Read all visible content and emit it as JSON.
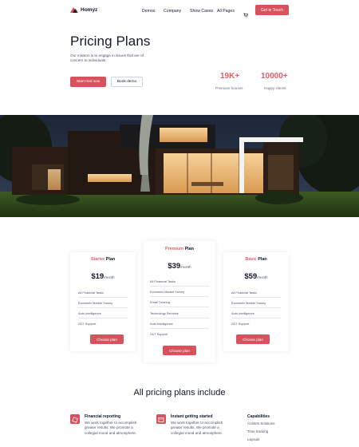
{
  "nav": {
    "brand": "Homyz",
    "menu": [
      "Demos",
      "Company",
      "Show Cases",
      "All Pages"
    ],
    "cta": "Get in Touch"
  },
  "hero": {
    "title": "Pricing Plans",
    "description": "Our mission is to engage in issues that are of concern to individuals",
    "primary_button": "Start trial now",
    "secondary_button": "Book demo",
    "stats": [
      {
        "value": "19K+",
        "label": "Premium houses"
      },
      {
        "value": "10000+",
        "label": "Happy clients"
      }
    ]
  },
  "plans": [
    {
      "name_accent": "Starter",
      "name_rest": " Plan",
      "price": "$19",
      "unit": "/month",
      "features": [
        "All Financial Tasks",
        "Economic Market Survey",
        "Auto Intelligence",
        "24/7 Support"
      ],
      "button": "Choose plan"
    },
    {
      "name_accent": "Premium",
      "name_rest": " Plan",
      "price": "$39",
      "unit": "/month",
      "features": [
        "All Financial Tasks",
        "Economic Market Survey",
        "Email Tutoring",
        "Technology Services",
        "Auto Intelligence",
        "24/7 Support"
      ],
      "button": "Choose plan"
    },
    {
      "name_accent": "Basic",
      "name_rest": " Plan",
      "price": "$59",
      "unit": "/month",
      "features": [
        "All Financial Tasks",
        "Economic Market Survey",
        "Auto Intelligence",
        "24/7 Support"
      ],
      "button": "Choose plan"
    }
  ],
  "includes": {
    "title": "All pricing plans include",
    "items": [
      {
        "heading": "Financial reporting",
        "body_lines": [
          "We work together to accomplish",
          "greater results. We promote a",
          "collegial mood and atmosphere."
        ]
      },
      {
        "heading": "Instant getting started",
        "body_lines": [
          "We work together to accomplish",
          "greater results. We promote a",
          "collegial mood and atmosphere."
        ]
      }
    ],
    "capabilities": {
      "heading": "Capabilities",
      "items": [
        "Custom Solutions",
        "Time tracking",
        "Layouts"
      ]
    }
  },
  "colors": {
    "accent": "#d9515c",
    "accent_text": "#e0606a"
  },
  "icons": [
    "logo-mark-icon",
    "cart-icon",
    "report-icon",
    "start-icon"
  ]
}
